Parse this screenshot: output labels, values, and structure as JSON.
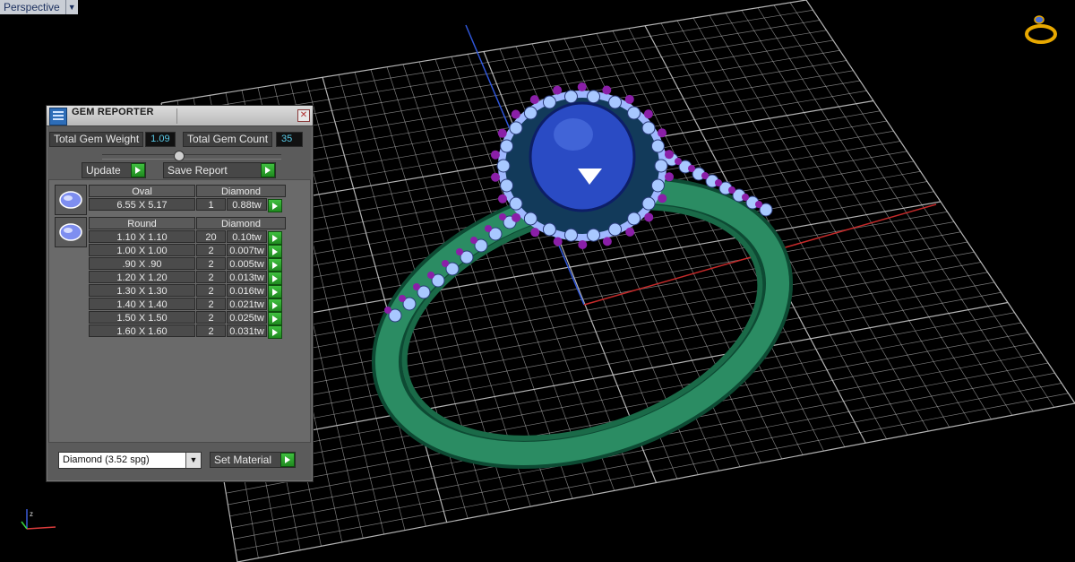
{
  "viewport": {
    "label": "Perspective",
    "dropdown_icon": "chevron-down-icon",
    "axis_icon": "xyz-axis-icon",
    "nav_icon": "ring-view-icon"
  },
  "panel": {
    "title": "GEM REPORTER",
    "total_weight_label": "Total Gem Weight",
    "total_weight_value": "1.09",
    "total_count_label": "Total Gem Count",
    "total_count_value": "35",
    "update_label": "Update",
    "save_report_label": "Save Report",
    "groups": [
      {
        "shape": "Oval",
        "material": "Diamond",
        "rows": [
          {
            "size": "6.55 X 5.17",
            "count": "1",
            "weight": "0.88tw"
          }
        ]
      },
      {
        "shape": "Round",
        "material": "Diamond",
        "rows": [
          {
            "size": "1.10 X 1.10",
            "count": "20",
            "weight": "0.10tw"
          },
          {
            "size": "1.00 X 1.00",
            "count": "2",
            "weight": "0.007tw"
          },
          {
            "size": ".90 X .90",
            "count": "2",
            "weight": "0.005tw"
          },
          {
            "size": "1.20 X 1.20",
            "count": "2",
            "weight": "0.013tw"
          },
          {
            "size": "1.30 X 1.30",
            "count": "2",
            "weight": "0.016tw"
          },
          {
            "size": "1.40 X 1.40",
            "count": "2",
            "weight": "0.021tw"
          },
          {
            "size": "1.50 X 1.50",
            "count": "2",
            "weight": "0.025tw"
          },
          {
            "size": "1.60 X 1.60",
            "count": "2",
            "weight": "0.031tw"
          }
        ]
      }
    ],
    "material_select": "Diamond     (3.52 spg)",
    "set_material_label": "Set Material"
  },
  "colors": {
    "grid": "#c8c8c8",
    "band": "#1f7a55",
    "prongs": "#8a1fa8",
    "center_stone": "#1f3fae",
    "accent_stones": "#a8c8ff"
  }
}
